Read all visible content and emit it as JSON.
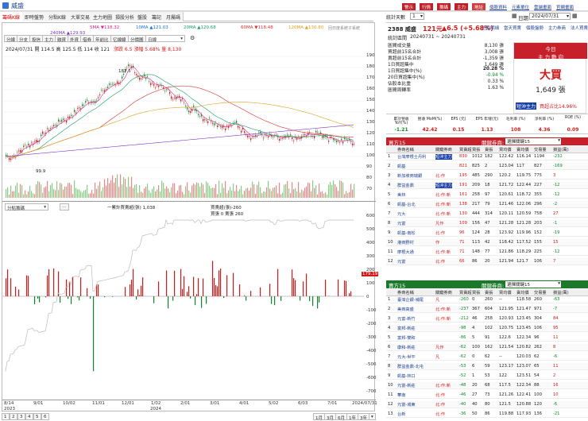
{
  "window": {
    "title": "威盛",
    "header_buttons": [
      "警示",
      "行情",
      "籌碼",
      "主力",
      "地址"
    ],
    "header_links": [
      "個股資料",
      "元素單位",
      "雲端畫面",
      "官網畫面"
    ]
  },
  "left_tabs": [
    "籌碼K線",
    "即時盤勢",
    "分點K線",
    "大單交易",
    "主力地圖",
    "損股分析",
    "盤股",
    "籌記",
    "月屬碼"
  ],
  "chart": {
    "tools": [
      "分線",
      "分支",
      "投信",
      "主力",
      "融資",
      "外資",
      "借券",
      "年前比",
      "亿線線",
      "分價圖",
      "日線"
    ],
    "ohlc_line": "2024/07/31  開 114.5  高 125.5  低 114  收 121",
    "change_line": "漲跌 6.5  漲幅 5.68%  量 8,130",
    "ma_legend": [
      {
        "label": "5MA ▼118.32",
        "color": "#e0248b"
      },
      {
        "label": "10MA ▲121.03",
        "color": "#1a74d8"
      },
      {
        "label": "20MA ▲120.68",
        "color": "#16a060"
      },
      {
        "label": "60MA ▼118.48",
        "color": "#d93030"
      },
      {
        "label": "240MA ▲129.93",
        "color": "#7a38c8"
      },
      {
        "label": "120MA ▲130.80",
        "color": "#e0a020"
      }
    ],
    "right_label": "回日度系統子系統",
    "peak_label": "182.5",
    "low_label": "99.9",
    "price_ticks": [
      "190",
      "180",
      "170",
      "160",
      "150",
      "140",
      "130",
      "120",
      "110",
      "100",
      "90",
      "80",
      "70"
    ],
    "lower_tool": "分點籌碼",
    "lower_legend": "一累計買賣超(張) 1,038",
    "lower_legend2": "買賣超(張)-260",
    "lower_legend3": "買張 0 賣張 260",
    "lower_ticks": [
      "600",
      "500",
      "400",
      "300",
      "200",
      "100",
      "0",
      "-100",
      "-200",
      "-300",
      "-400",
      "-500",
      "-600",
      "-700"
    ],
    "lower_tag": "179.19",
    "x_ticks": [
      "8/14",
      "9/01",
      "10/02",
      "11/01",
      "12/01",
      "1/02",
      "2/01",
      "3/01",
      "4/01",
      "5/02",
      "6/03",
      "7/01",
      "2024/07/31"
    ],
    "x_years": [
      "2023",
      "2024"
    ],
    "range_buttons": [
      "1月",
      "3月",
      "6月",
      "1年",
      "3年",
      "▾"
    ],
    "pages": [
      "1",
      "2",
      "3",
      "4",
      "5",
      "6"
    ]
  },
  "right": {
    "stat_label": "統計天數",
    "stat_value": "1",
    "date_label": "日期",
    "date_value": "2024/07/31",
    "stock": "2388 威盛",
    "price": "121元",
    "change": "▲6.5 (+5.68%)",
    "period_label": "統計區間",
    "period": "20240731 ~ 20240731",
    "tabs": [
      "分點明細",
      "當天買賣",
      "個股盤勢",
      "主力券商",
      "法人買賣"
    ],
    "summary": [
      {
        "label": "區間成交量",
        "value": "8,130 張"
      },
      {
        "label": "買超前15名合計",
        "value": "3,008 張"
      },
      {
        "label": "賣超前15名合計",
        "value": "-1,359 張"
      },
      {
        "label": "1日買超集中",
        "value": "1,649 張"
      },
      {
        "label": "1日買超集中(%)",
        "value": "20.28 %"
      },
      {
        "label": "20日買超集中(%)",
        "value": "-0.94 %"
      },
      {
        "label": "佔股本比重",
        "value": "0.33 %"
      },
      {
        "label": "區間周轉率",
        "value": "1.63 %"
      }
    ],
    "today_title": "今日",
    "today_sub": "主 力 動 向",
    "today_big": "大買",
    "today_amount": "1,649 張",
    "badge1": "短沖主力",
    "badge2": "買超占比14.96%",
    "metric_headers": [
      "累計營收 YoY(%)",
      "營收 MoM(%)",
      "EPS (元)",
      "EPS 年增(元)",
      "毛利率 (%)",
      "淨利率 (%)",
      "ROE (%)"
    ],
    "metric_values": [
      "-1.21",
      "42.42",
      "0.15",
      "1.13",
      "108",
      "4.36",
      "0.09"
    ],
    "buy_title": "買方15",
    "sell_title": "賣方15",
    "filter_label": "關鍵券商:",
    "filter_value": "選擇關鍵15",
    "col_headers": [
      "",
      "券商名稱",
      "關鍵券商",
      "買賣超",
      "買張",
      "賣張",
      "買均價",
      "賣均價",
      "交易量",
      "損益(萬)"
    ],
    "buy_rows": [
      [
        "1",
        "台灣摩根士丹利",
        "短沖主力",
        "830",
        "1012",
        "182",
        "122.42",
        "116.14",
        "1194",
        "-232"
      ],
      [
        "2",
        "凱基",
        "",
        "821",
        "825",
        "2",
        "123.04",
        "117",
        "827",
        "-169"
      ],
      [
        "3",
        "新加坡商瑞銀",
        "北:作",
        "195",
        "485",
        "290",
        "120.2",
        "119.75",
        "775",
        "3"
      ],
      [
        "4",
        "群益金鼎",
        "短沖主力",
        "191",
        "209",
        "18",
        "121.72",
        "122.44",
        "227",
        "-12"
      ],
      [
        "5",
        "美林",
        "北:作:新",
        "161",
        "258",
        "97",
        "120.61",
        "118.72",
        "355",
        "-12"
      ],
      [
        "6",
        "凱基-台北",
        "北:作:新",
        "138",
        "217",
        "79",
        "121.46",
        "122.06",
        "296",
        "-2"
      ],
      [
        "7",
        "元大",
        "北:作:新",
        "130",
        "444",
        "314",
        "120.11",
        "120.59",
        "758",
        "27"
      ],
      [
        "8",
        "元富",
        "凡作",
        "109",
        "156",
        "47",
        "121.28",
        "121.28",
        "203",
        "-1"
      ],
      [
        "9",
        "凱基-南松",
        "北:作",
        "96",
        "124",
        "28",
        "123.92",
        "119.96",
        "152",
        "-19"
      ],
      [
        "10",
        "港商野村",
        "作",
        "71",
        "113",
        "42",
        "118.42",
        "117.52",
        "155",
        "15"
      ],
      [
        "11",
        "摩根大通",
        "北:作:新",
        "71",
        "148",
        "77",
        "121.86",
        "118.29",
        "225",
        "-12"
      ],
      [
        "12",
        "元富",
        "北:作",
        "66",
        "86",
        "20",
        "121.94",
        "121.7",
        "106",
        "7"
      ]
    ],
    "sell_rows": [
      [
        "1",
        "臺灣企銀-埔尾",
        "凡",
        "-260",
        "0",
        "260",
        "--",
        "118.58",
        "260",
        "-63"
      ],
      [
        "2",
        "美商高盛",
        "北:作:新",
        "-237",
        "367",
        "604",
        "121.95",
        "121.47",
        "971",
        "-7"
      ],
      [
        "3",
        "元富-新竹",
        "北:作:新",
        "-212",
        "46",
        "258",
        "120.93",
        "123.45",
        "304",
        "84"
      ],
      [
        "4",
        "富邦-新莊",
        "",
        "-98",
        "4",
        "102",
        "120.75",
        "123.45",
        "106",
        "95"
      ],
      [
        "5",
        "富邦-雙和",
        "",
        "-86",
        "5",
        "91",
        "122.6",
        "122.34",
        "96",
        "11"
      ],
      [
        "6",
        "康和-新莊",
        "凡作",
        "-62",
        "100",
        "162",
        "121.54",
        "120.82",
        "262",
        "8"
      ],
      [
        "7",
        "元大-世平",
        "凡",
        "-62",
        "0",
        "62",
        "--",
        "120.03",
        "62",
        "-6"
      ],
      [
        "8",
        "群益金鼎-北屯",
        "",
        "-53",
        "6",
        "59",
        "123.17",
        "123.07",
        "65",
        "11"
      ],
      [
        "9",
        "凱基-林口",
        "",
        "-52",
        "1",
        "53",
        "122",
        "123.51",
        "54",
        "2"
      ],
      [
        "10",
        "元富-新莊",
        "北:作:新",
        "-48",
        "20",
        "68",
        "117.5",
        "122.34",
        "88",
        "16"
      ],
      [
        "11",
        "華南",
        "北:作",
        "-46",
        "27",
        "73",
        "121.26",
        "122.41",
        "100",
        "10"
      ],
      [
        "12",
        "元富-城東",
        "北:作",
        "-40",
        "40",
        "80",
        "121.5",
        "120.88",
        "120",
        "-6"
      ],
      [
        "13",
        "台新",
        "北:作",
        "-36",
        "50",
        "86",
        "119.88",
        "117.93",
        "136",
        "-21"
      ]
    ]
  },
  "colors": {
    "up": "#d21a1a",
    "down": "#0a8a2a",
    "brand": "#1a3f8f",
    "buy_head": "#c8202a",
    "sell_head": "#1a7a2a"
  }
}
